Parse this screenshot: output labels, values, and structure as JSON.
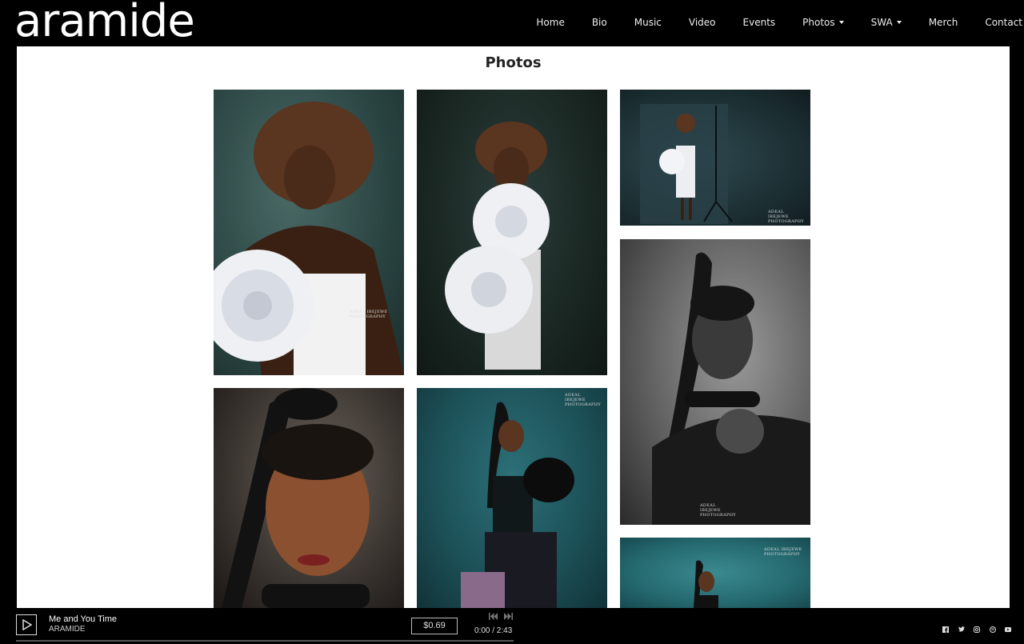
{
  "header": {
    "logo": "aramide",
    "nav": [
      {
        "label": "Home"
      },
      {
        "label": "Bio"
      },
      {
        "label": "Music"
      },
      {
        "label": "Video"
      },
      {
        "label": "Events"
      },
      {
        "label": "Photos",
        "dropdown": true
      },
      {
        "label": "SWA",
        "dropdown": true
      },
      {
        "label": "Merch"
      },
      {
        "label": "Contact"
      }
    ]
  },
  "main": {
    "title": "Photos",
    "watermark": "ADEAL IBEJEWE PHOTOGRAPHY",
    "photos": [
      {
        "name": "photo-white-flower-dress-closeup",
        "bg": "#2e4a48"
      },
      {
        "name": "photo-white-flower-dress-hands-up",
        "bg": "#1c2b28"
      },
      {
        "name": "photo-white-dress-studio-full",
        "bg": "#1d3136"
      },
      {
        "name": "photo-portrait-braid-black-white",
        "bg": "#6e6e6e"
      },
      {
        "name": "photo-portrait-braid-closeup-color",
        "bg": "#3a3430"
      },
      {
        "name": "photo-seated-teal-background",
        "bg": "#1f5a62"
      },
      {
        "name": "photo-teal-background-partial",
        "bg": "#2a6e74"
      }
    ]
  },
  "player": {
    "track_title": "Me and You Time",
    "artist": "ARAMIDE",
    "price": "$0.69",
    "time": "0:00 / 2:43",
    "progress": 0
  },
  "social": [
    "facebook-icon",
    "twitter-icon",
    "instagram-icon",
    "spotify-icon",
    "youtube-icon"
  ]
}
